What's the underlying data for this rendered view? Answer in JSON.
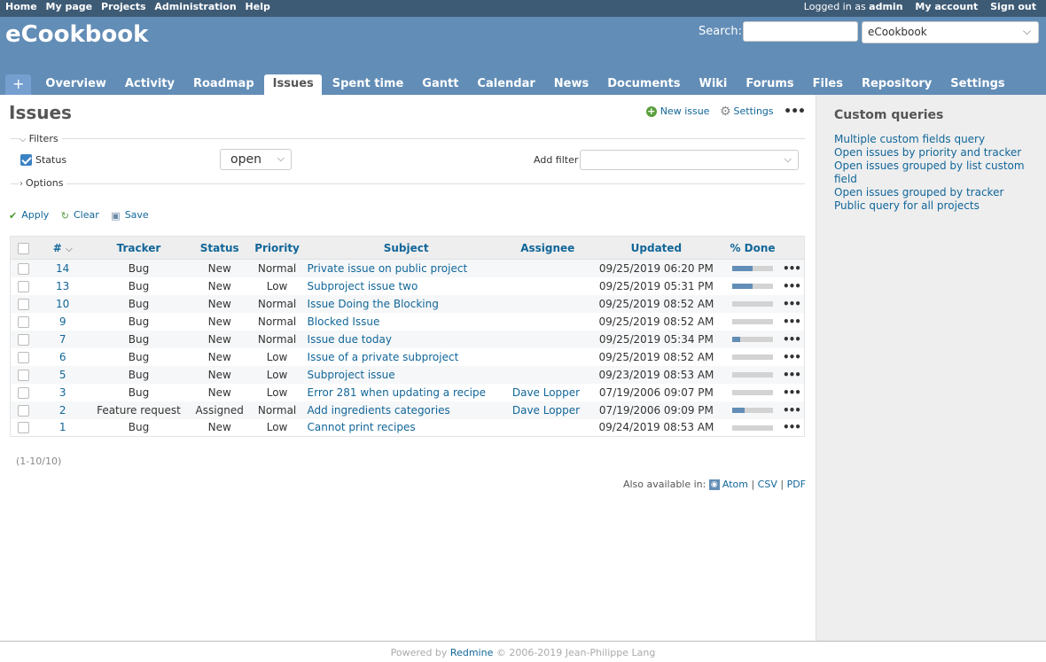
{
  "top_menu": {
    "left": [
      "Home",
      "My page",
      "Projects",
      "Administration",
      "Help"
    ],
    "logged_prefix": "Logged in as",
    "logged_user": "admin",
    "my_account": "My account",
    "sign_out": "Sign out"
  },
  "header": {
    "title": "eCookbook",
    "search_label": "Search:",
    "search_value": "",
    "project_selected": "eCookbook"
  },
  "main_menu": {
    "plus": "+",
    "tabs": [
      "Overview",
      "Activity",
      "Roadmap",
      "Issues",
      "Spent time",
      "Gantt",
      "Calendar",
      "News",
      "Documents",
      "Wiki",
      "Forums",
      "Files",
      "Repository",
      "Settings"
    ],
    "selected": "Issues"
  },
  "page": {
    "title": "Issues",
    "new_issue": "New issue",
    "settings": "Settings",
    "filters_legend": "Filters",
    "status_label": "Status",
    "status_operator": "open",
    "add_filter_label": "Add filter",
    "options_legend": "Options",
    "apply": "Apply",
    "clear": "Clear",
    "save": "Save",
    "pagination": "(1-10/10)",
    "also_available": "Also available in:",
    "formats": [
      "Atom",
      "CSV",
      "PDF"
    ]
  },
  "table": {
    "headers": [
      "#",
      "Tracker",
      "Status",
      "Priority",
      "Subject",
      "Assignee",
      "Updated",
      "% Done"
    ],
    "rows": [
      {
        "id": "14",
        "tracker": "Bug",
        "status": "New",
        "priority": "Normal",
        "subject": "Private issue on public project",
        "assignee": "",
        "updated": "09/25/2019 06:20 PM",
        "done": 0.5
      },
      {
        "id": "13",
        "tracker": "Bug",
        "status": "New",
        "priority": "Low",
        "subject": "Subproject issue two",
        "assignee": "",
        "updated": "09/25/2019 05:31 PM",
        "done": 0.5
      },
      {
        "id": "10",
        "tracker": "Bug",
        "status": "New",
        "priority": "Normal",
        "subject": "Issue Doing the Blocking",
        "assignee": "",
        "updated": "09/25/2019 08:52 AM",
        "done": 0
      },
      {
        "id": "9",
        "tracker": "Bug",
        "status": "New",
        "priority": "Normal",
        "subject": "Blocked Issue",
        "assignee": "",
        "updated": "09/25/2019 08:52 AM",
        "done": 0
      },
      {
        "id": "7",
        "tracker": "Bug",
        "status": "New",
        "priority": "Normal",
        "subject": "Issue due today",
        "assignee": "",
        "updated": "09/25/2019 05:34 PM",
        "done": 0.2
      },
      {
        "id": "6",
        "tracker": "Bug",
        "status": "New",
        "priority": "Low",
        "subject": "Issue of a private subproject",
        "assignee": "",
        "updated": "09/25/2019 08:52 AM",
        "done": 0
      },
      {
        "id": "5",
        "tracker": "Bug",
        "status": "New",
        "priority": "Low",
        "subject": "Subproject issue",
        "assignee": "",
        "updated": "09/23/2019 08:53 AM",
        "done": 0
      },
      {
        "id": "3",
        "tracker": "Bug",
        "status": "New",
        "priority": "Low",
        "subject": "Error 281 when updating a recipe",
        "assignee": "Dave Lopper",
        "updated": "07/19/2006 09:07 PM",
        "done": 0
      },
      {
        "id": "2",
        "tracker": "Feature request",
        "status": "Assigned",
        "priority": "Normal",
        "subject": "Add ingredients categories",
        "assignee": "Dave Lopper",
        "updated": "07/19/2006 09:09 PM",
        "done": 0.3
      },
      {
        "id": "1",
        "tracker": "Bug",
        "status": "New",
        "priority": "Low",
        "subject": "Cannot print recipes",
        "assignee": "",
        "updated": "09/24/2019 08:53 AM",
        "done": 0
      }
    ]
  },
  "sidebar": {
    "title": "Custom queries",
    "queries": [
      "Multiple custom fields query",
      "Open issues by priority and tracker",
      "Open issues grouped by list custom field",
      "Open issues grouped by tracker",
      "Public query for all projects"
    ]
  },
  "footer": {
    "prefix": "Powered by",
    "link": "Redmine",
    "suffix": "© 2006-2019 Jean-Philippe Lang"
  },
  "colors": {
    "top_menu_bg": "#3E5B76",
    "header_bg": "#628DB6",
    "link": "#169",
    "progress_fill": "#628DB6"
  }
}
